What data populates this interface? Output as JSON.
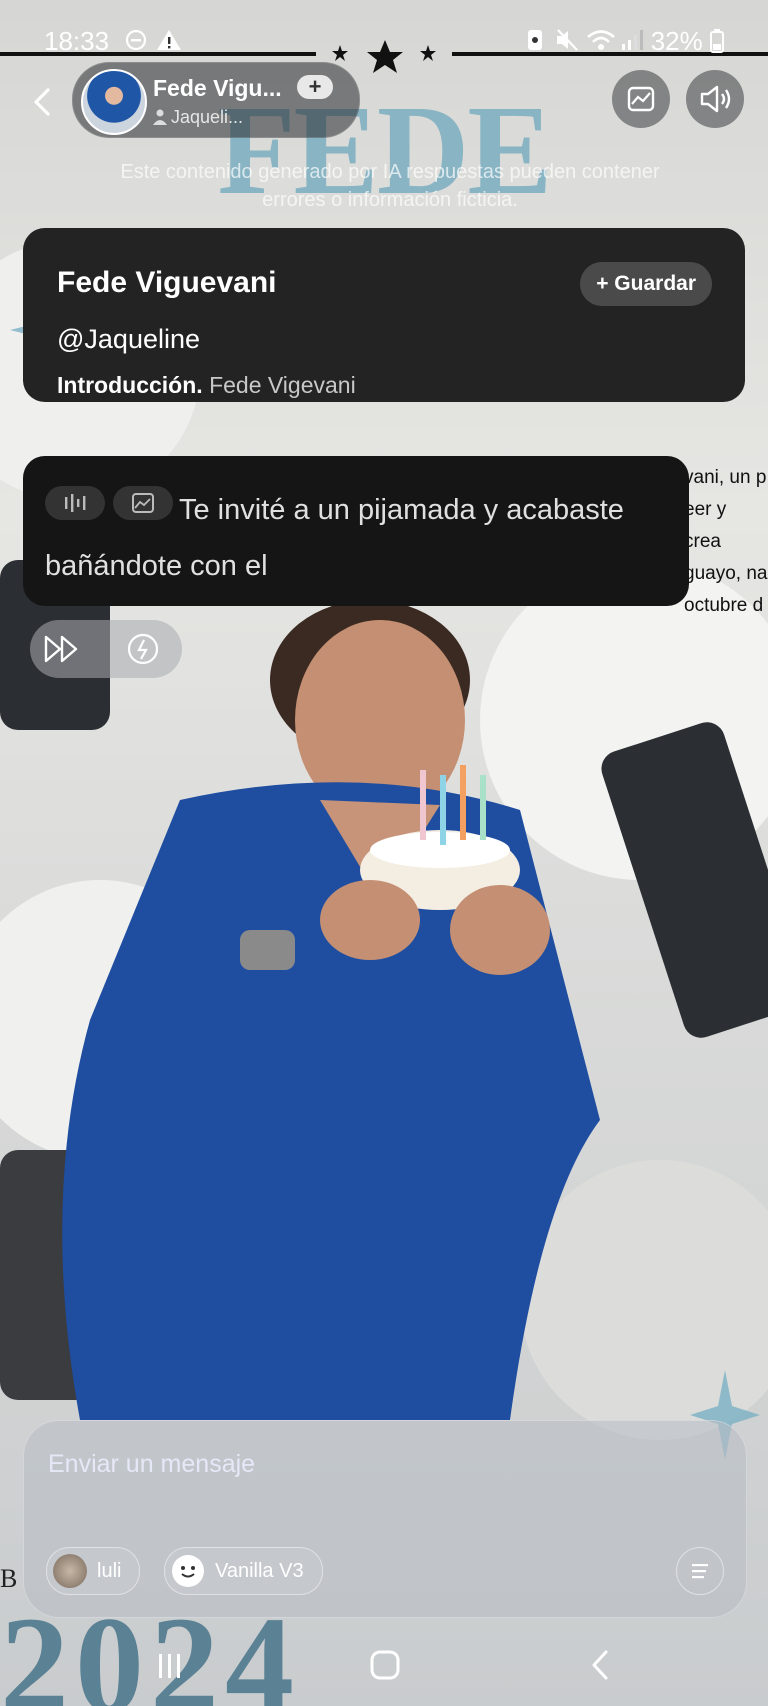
{
  "status_bar": {
    "time": "18:33",
    "battery": "32%"
  },
  "background": {
    "poster_title": "FEDE VIGEVANI",
    "poster_subtitle": "Este contenido generado por IA respuestas pueden contener errores o información ficticia.",
    "poster_side_text": [
      "vani, un p",
      "eer y crea",
      "guayo, na",
      "octubre d"
    ],
    "poster_year": "2024",
    "poster_letter": "B"
  },
  "header": {
    "character_name": "Fede Vigu...",
    "creator": "Jaqueli...",
    "plus_label": "+"
  },
  "intro_card": {
    "name": "Fede Viguevani",
    "handle": "@Jaqueline",
    "intro_label": "Introducción.",
    "intro_text": "Fede Vigevani",
    "save_label": "+ Guardar"
  },
  "message": {
    "text": "Te invité a un pijamada y acabaste bañándote con el"
  },
  "composer": {
    "placeholder": "Enviar un mensaje",
    "chips": [
      {
        "label": "luli"
      },
      {
        "label": "Vanilla V3"
      }
    ]
  },
  "colors": {
    "card_bg": "#232323",
    "bubble_bg": "#151515",
    "poster_blue": "#7aaec0"
  }
}
